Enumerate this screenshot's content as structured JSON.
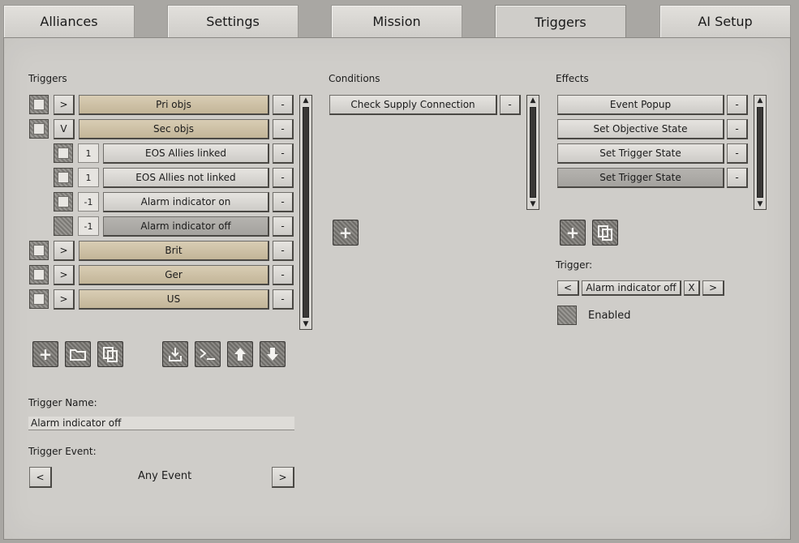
{
  "tabs": [
    "Alliances",
    "Settings",
    "Mission",
    "Triggers",
    "AI Setup"
  ],
  "active_tab": "Triggers",
  "triggers_panel": {
    "header": "Triggers",
    "rows": [
      {
        "toggle": ">",
        "label": "Pri objs",
        "checked": true,
        "indent": false
      },
      {
        "toggle": "V",
        "label": "Sec objs",
        "checked": true,
        "indent": false
      },
      {
        "toggle": "1",
        "label": "EOS Allies linked",
        "checked": true,
        "indent": true
      },
      {
        "toggle": "1",
        "label": "EOS Allies not linked",
        "checked": true,
        "indent": true
      },
      {
        "toggle": "-1",
        "label": "Alarm indicator on",
        "checked": true,
        "indent": true
      },
      {
        "toggle": "-1",
        "label": "Alarm indicator off",
        "checked": false,
        "indent": true,
        "selected": true
      },
      {
        "toggle": ">",
        "label": "Brit",
        "checked": true,
        "indent": false
      },
      {
        "toggle": ">",
        "label": "Ger",
        "checked": true,
        "indent": false
      },
      {
        "toggle": ">",
        "label": "US",
        "checked": true,
        "indent": false
      }
    ],
    "remove_label": "-",
    "trigger_name_label": "Trigger Name:",
    "trigger_name_value": "Alarm indicator off",
    "trigger_event_label": "Trigger Event:",
    "trigger_event_value": "Any Event",
    "prev": "<",
    "next": ">"
  },
  "conditions_panel": {
    "header": "Conditions",
    "items": [
      "Check Supply Connection"
    ],
    "remove_label": "-"
  },
  "effects_panel": {
    "header": "Effects",
    "items": [
      "Event Popup",
      "Set Objective State",
      "Set Trigger State",
      "Set Trigger State"
    ],
    "remove_label": "-",
    "trigger_label": "Trigger:",
    "trigger_value": "Alarm indicator off",
    "prev": "<",
    "clear": "X",
    "next": ">",
    "enabled_label": "Enabled"
  },
  "colors": {
    "tan": "#cdbfa3",
    "panel": "#cfcdc9"
  },
  "icons": [
    "plus-icon",
    "folder-icon",
    "copy-icon",
    "import-icon",
    "console-icon",
    "arrow-up-icon",
    "arrow-down-icon"
  ]
}
